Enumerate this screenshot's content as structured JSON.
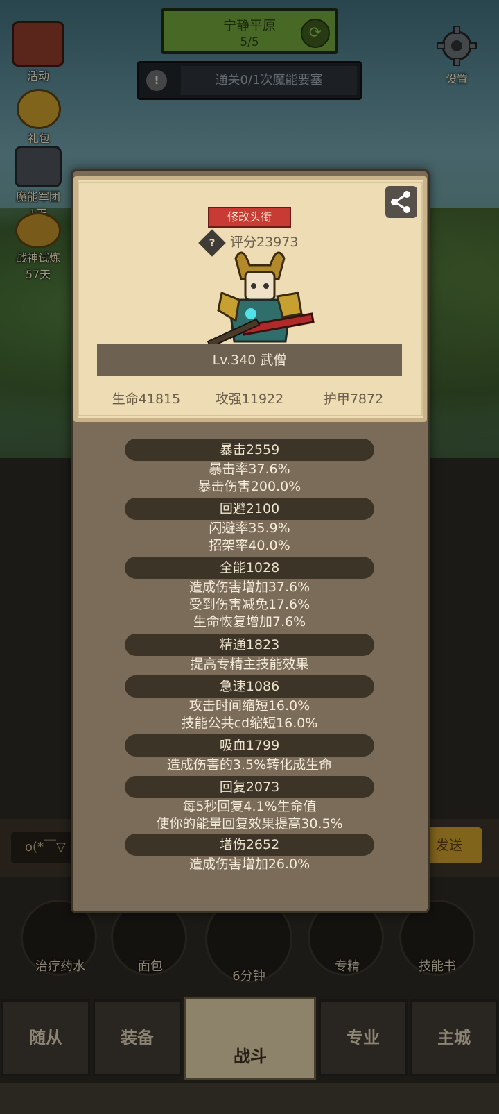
{
  "stage": {
    "name": "宁静平原",
    "progress": "5/5"
  },
  "task": {
    "text": "通关0/1次魔能要塞"
  },
  "side_menu": [
    {
      "label": "活动"
    },
    {
      "label": "礼包"
    },
    {
      "label": "魔能军团",
      "timer": "1天"
    },
    {
      "label": "战神试炼",
      "timer": "57天"
    }
  ],
  "settings_label": "设置",
  "character": {
    "title_button": "修改头衔",
    "score": "评分23973",
    "level_class": "Lv.340 武僧",
    "hp": "生命41815",
    "attack": "攻强11922",
    "armor": "护甲7872"
  },
  "stats": [
    {
      "title": "暴击2559",
      "lines": [
        "暴击率37.6%",
        "暴击伤害200.0%"
      ]
    },
    {
      "title": "回避2100",
      "lines": [
        "闪避率35.9%",
        "招架率40.0%"
      ]
    },
    {
      "title": "全能1028",
      "lines": [
        "造成伤害增加37.6%",
        "受到伤害减免17.6%",
        "生命恢复增加7.6%"
      ]
    },
    {
      "title": "精通1823",
      "lines": [
        "提高专精主技能效果"
      ]
    },
    {
      "title": "急速1086",
      "lines": [
        "攻击时间缩短16.0%",
        "技能公共cd缩短16.0%"
      ]
    },
    {
      "title": "吸血1799",
      "lines": [
        "造成伤害的3.5%转化成生命"
      ]
    },
    {
      "title": "回复2073",
      "lines": [
        "每5秒回复4.1%生命值",
        "使你的能量回复效果提高30.5%"
      ]
    },
    {
      "title": "增伤2652",
      "lines": [
        "造成伤害增加26.0%"
      ]
    }
  ],
  "chat": {
    "input_text": "o(*￣▽",
    "send_label": "发送"
  },
  "items": [
    {
      "label": "治疗药水"
    },
    {
      "label": "面包"
    },
    {
      "label": "6分钟"
    },
    {
      "label": "专精"
    },
    {
      "label": "技能书"
    }
  ],
  "nav": [
    {
      "label": "随从"
    },
    {
      "label": "装备"
    },
    {
      "label": "战斗"
    },
    {
      "label": "专业"
    },
    {
      "label": "主城"
    }
  ],
  "colors": {
    "title_button": "#c83a34",
    "stage_green": "#6fa13a",
    "panel": "#7a6c59",
    "card": "#eddcb4"
  }
}
